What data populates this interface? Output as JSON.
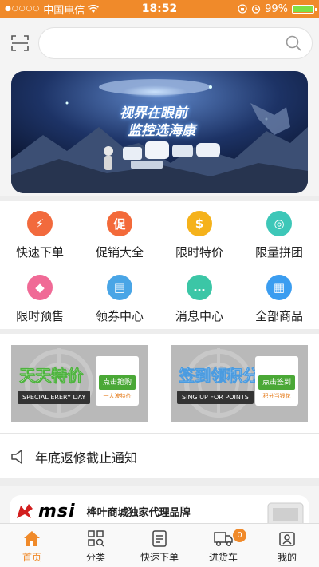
{
  "status_bar": {
    "carrier": "中国电信",
    "time": "18:52",
    "battery": "99%",
    "battery_level": 0.99
  },
  "search": {
    "placeholder": ""
  },
  "banner": {
    "line1": "视界在眼前",
    "line2": "监控选海康"
  },
  "quick_menu": [
    {
      "label": "快速下单",
      "icon": "lightning-icon",
      "glyph": "⚡",
      "color": "#f26a3d"
    },
    {
      "label": "促销大全",
      "icon": "promotion-icon",
      "glyph": "促",
      "color": "#f36a3a"
    },
    {
      "label": "限时特价",
      "icon": "money-bag-icon",
      "glyph": "$",
      "color": "#f5b21b"
    },
    {
      "label": "限量拼团",
      "icon": "group-icon",
      "glyph": "◎",
      "color": "#3dc7b8"
    },
    {
      "label": "限时预售",
      "icon": "tag-icon",
      "glyph": "◆",
      "color": "#f06a96"
    },
    {
      "label": "领券中心",
      "icon": "coupon-icon",
      "glyph": "▤",
      "color": "#49a5e6"
    },
    {
      "label": "消息中心",
      "icon": "message-icon",
      "glyph": "…",
      "color": "#3bc6a6"
    },
    {
      "label": "全部商品",
      "icon": "all-products-icon",
      "glyph": "▦",
      "color": "#3b9df0"
    }
  ],
  "promos": [
    {
      "title": "天天特价",
      "subtitle": "SPECIAL ERERY DAY",
      "button": "点击抢购",
      "small": "一大波特价",
      "title_color": "#4db33d"
    },
    {
      "title": "签到领积分",
      "subtitle": "SING UP FOR POINTS",
      "button": "点击签到",
      "small": "积分当钱花",
      "title_color": "#4a9be0"
    }
  ],
  "notice": {
    "text": "年底返修截止通知"
  },
  "brand": {
    "logo": "msi",
    "text": "桦叶商城独家代理品牌"
  },
  "tabbar": [
    {
      "label": "首页",
      "icon": "home-icon",
      "active": true
    },
    {
      "label": "分类",
      "icon": "category-icon",
      "active": false
    },
    {
      "label": "快速下单",
      "icon": "order-list-icon",
      "active": false
    },
    {
      "label": "进货车",
      "icon": "truck-icon",
      "active": false,
      "badge": "0"
    },
    {
      "label": "我的",
      "icon": "profile-icon",
      "active": false
    }
  ],
  "colors": {
    "accent": "#f08a2a",
    "battery_green": "#7ee046"
  }
}
